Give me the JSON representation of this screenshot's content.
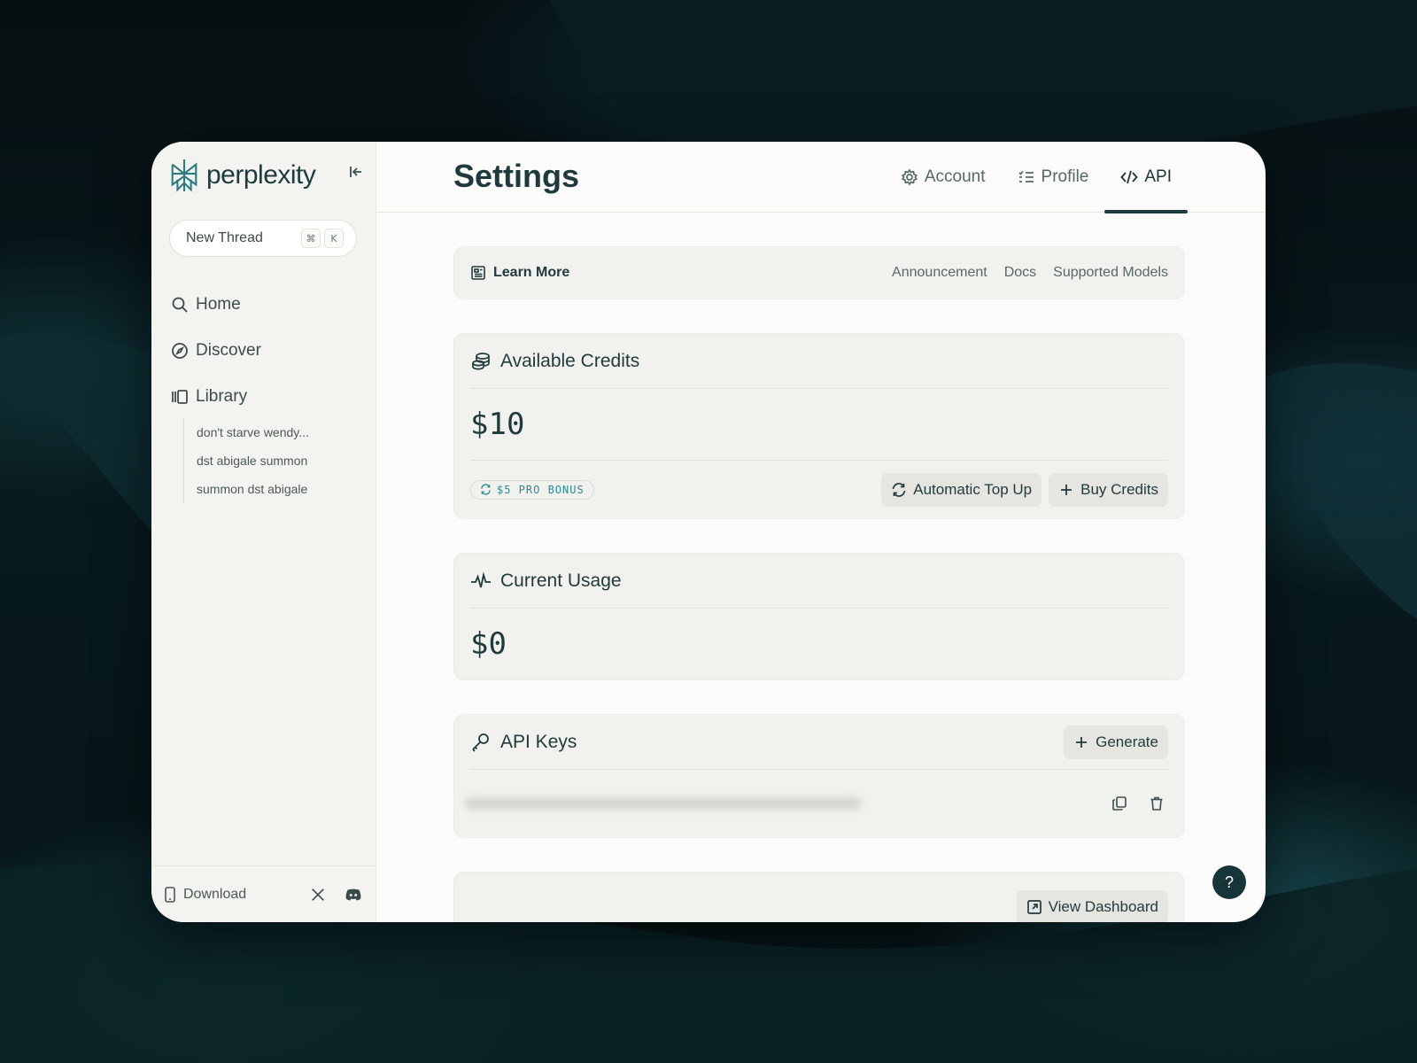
{
  "brand": {
    "name": "perplexity"
  },
  "sidebar": {
    "new_thread": {
      "label": "New Thread",
      "shortcut_keys": [
        "⌘",
        "K"
      ]
    },
    "nav": [
      {
        "label": "Home",
        "icon": "search-icon"
      },
      {
        "label": "Discover",
        "icon": "compass-icon"
      },
      {
        "label": "Library",
        "icon": "library-icon"
      }
    ],
    "library_items": [
      "don't starve wendy...",
      "dst abigale summon",
      "summon dst abigale"
    ],
    "footer": {
      "download_label": "Download"
    }
  },
  "header": {
    "title": "Settings",
    "tabs": [
      {
        "label": "Account",
        "icon": "gear-icon"
      },
      {
        "label": "Profile",
        "icon": "list-icon"
      },
      {
        "label": "API",
        "icon": "code-icon",
        "active": true
      }
    ]
  },
  "learn_more": {
    "label": "Learn More",
    "links": [
      "Announcement",
      "Docs",
      "Supported Models"
    ]
  },
  "credits": {
    "title": "Available Credits",
    "amount": "$10",
    "bonus": "$5 PRO BONUS",
    "auto_top_up_label": "Automatic Top Up",
    "buy_label": "Buy Credits"
  },
  "usage": {
    "title": "Current Usage",
    "amount": "$0"
  },
  "api_keys": {
    "title": "API Keys",
    "generate_label": "Generate"
  },
  "dashboard": {
    "label": "View Dashboard"
  },
  "help": {
    "label": "?"
  },
  "colors": {
    "accent": "#1d3a3e",
    "brand_teal": "#2a7a80",
    "window_bg": "#fbfbf9",
    "sidebar_bg": "#f3f3ef"
  }
}
